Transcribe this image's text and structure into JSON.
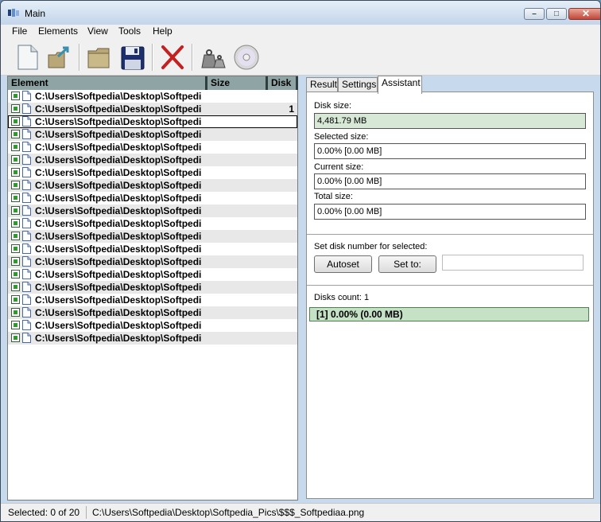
{
  "window": {
    "title": "Main"
  },
  "menu": [
    "File",
    "Elements",
    "View",
    "Tools",
    "Help"
  ],
  "toolbar": {
    "icons": [
      "new-document-icon",
      "open-folder-arrow-icon",
      "folder-icon",
      "save-disk-icon",
      "delete-x-icon",
      "weights-icon",
      "cd-disc-icon"
    ]
  },
  "list": {
    "columns": {
      "element": "Element",
      "size": "Size",
      "disk": "Disk"
    },
    "rows": [
      {
        "path": "C:\\Users\\Softpedia\\Desktop\\Softpedi",
        "disk": ""
      },
      {
        "path": "C:\\Users\\Softpedia\\Desktop\\Softpedi",
        "disk": "1"
      },
      {
        "path": "C:\\Users\\Softpedia\\Desktop\\Softpedi",
        "disk": ""
      },
      {
        "path": "C:\\Users\\Softpedia\\Desktop\\Softpedi",
        "disk": ""
      },
      {
        "path": "C:\\Users\\Softpedia\\Desktop\\Softpedi",
        "disk": ""
      },
      {
        "path": "C:\\Users\\Softpedia\\Desktop\\Softpedi",
        "disk": ""
      },
      {
        "path": "C:\\Users\\Softpedia\\Desktop\\Softpedi",
        "disk": ""
      },
      {
        "path": "C:\\Users\\Softpedia\\Desktop\\Softpedi",
        "disk": ""
      },
      {
        "path": "C:\\Users\\Softpedia\\Desktop\\Softpedi",
        "disk": ""
      },
      {
        "path": "C:\\Users\\Softpedia\\Desktop\\Softpedi",
        "disk": ""
      },
      {
        "path": "C:\\Users\\Softpedia\\Desktop\\Softpedi",
        "disk": ""
      },
      {
        "path": "C:\\Users\\Softpedia\\Desktop\\Softpedi",
        "disk": ""
      },
      {
        "path": "C:\\Users\\Softpedia\\Desktop\\Softpedi",
        "disk": ""
      },
      {
        "path": "C:\\Users\\Softpedia\\Desktop\\Softpedi",
        "disk": ""
      },
      {
        "path": "C:\\Users\\Softpedia\\Desktop\\Softpedi",
        "disk": ""
      },
      {
        "path": "C:\\Users\\Softpedia\\Desktop\\Softpedi",
        "disk": ""
      },
      {
        "path": "C:\\Users\\Softpedia\\Desktop\\Softpedi",
        "disk": ""
      },
      {
        "path": "C:\\Users\\Softpedia\\Desktop\\Softpedi",
        "disk": ""
      },
      {
        "path": "C:\\Users\\Softpedia\\Desktop\\Softpedi",
        "disk": ""
      },
      {
        "path": "C:\\Users\\Softpedia\\Desktop\\Softpedi",
        "disk": ""
      }
    ]
  },
  "tabs": [
    "Result",
    "Settings",
    "Assistant"
  ],
  "active_tab": "Assistant",
  "assistant": {
    "disk_size_label": "Disk size:",
    "disk_size_value": "4,481.79 MB",
    "selected_size_label": "Selected size:",
    "selected_size_value": "0.00% [0.00 MB]",
    "current_size_label": "Current size:",
    "current_size_value": "0.00% [0.00 MB]",
    "total_size_label": "Total size:",
    "total_size_value": "0.00% [0.00 MB]",
    "set_disk_label": "Set disk number for selected:",
    "autoset_label": "Autoset",
    "set_to_label": "Set to:",
    "disks_count_label": "Disks count: 1",
    "disk_entry": "[1] 0.00% (0.00 MB)"
  },
  "status": {
    "selected": "Selected: 0 of 20",
    "path": "C:\\Users\\Softpedia\\Desktop\\Softpedia_Pics\\$$$_Softpediaa.png"
  },
  "colors": {
    "header_bg": "#8fa5a5",
    "disk_row_bg": "#c6e2c6",
    "disk_size_bg": "#d7e8d7"
  }
}
